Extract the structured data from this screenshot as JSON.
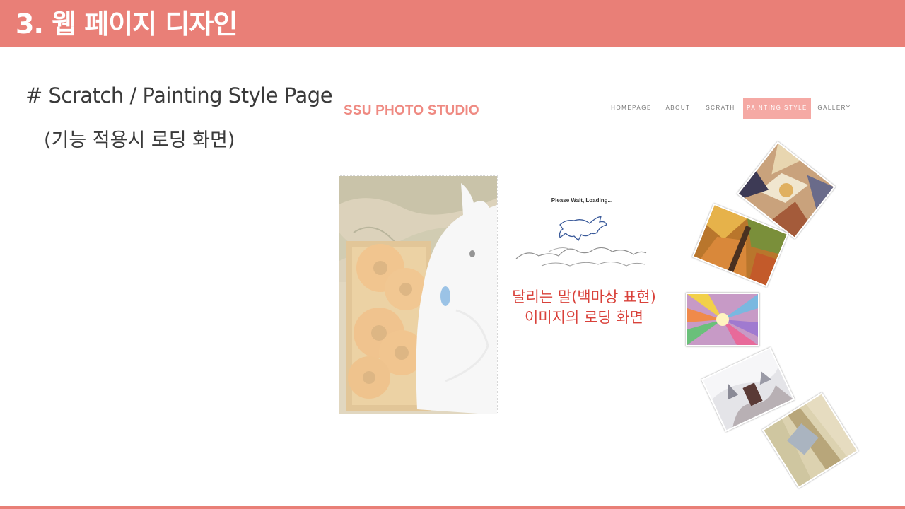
{
  "slide": {
    "title": "3. 웹 페이지 디자인",
    "heading": "# Scratch / Painting Style Page",
    "subheading": "(기능 적용시 로딩 화면)"
  },
  "site": {
    "logo": "SSU PHOTO STUDIO",
    "nav": [
      {
        "label": "HOMEPAGE",
        "active": false
      },
      {
        "label": "ABOUT",
        "active": false
      },
      {
        "label": "SCRATH",
        "active": false
      },
      {
        "label": "PAINTING STYLE",
        "active": true
      },
      {
        "label": "GALLERY",
        "active": false
      }
    ],
    "loading_text": "Please Wait, Loading...",
    "caption_line1": "달리는 말(백마상 표현)",
    "caption_line2": "이미지의 로딩 화면"
  },
  "colors": {
    "header": "#e97f77",
    "logo": "#ef8a82",
    "nav_active_bg": "#f5a9a4",
    "caption": "#d9413a"
  },
  "images": {
    "main_photo": "donuts-and-white-plush-toy-photo",
    "loading_icon": "running-horse-sketch-icon",
    "gallery": [
      "abstract-colorful-painting",
      "autumn-forest-painting",
      "radial-color-burst-painting",
      "snowy-landscape-painting",
      "pastel-abstract-painting"
    ]
  }
}
